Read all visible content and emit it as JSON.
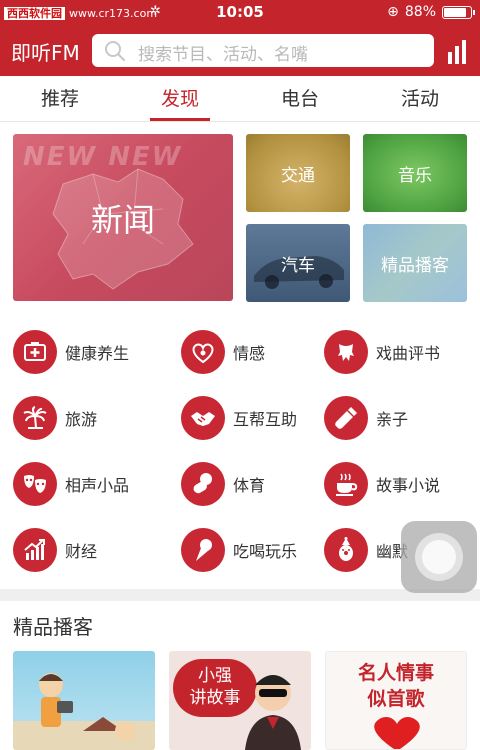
{
  "status_bar": {
    "site_name": "西西软件园",
    "site_url": "www.cr173.com",
    "time": "10:05",
    "battery_percent": "88%",
    "battery_level": 0.88
  },
  "header": {
    "brand": "即听FM",
    "search_placeholder": "搜索节目、活动、名嘴"
  },
  "tabs": [
    {
      "label": "推荐",
      "active": false
    },
    {
      "label": "发现",
      "active": true
    },
    {
      "label": "电台",
      "active": false
    },
    {
      "label": "活动",
      "active": false
    }
  ],
  "banners": {
    "news": {
      "label": "新闻",
      "ghost_text": "NEW NEW"
    },
    "traffic": {
      "label": "交通"
    },
    "music": {
      "label": "音乐"
    },
    "car": {
      "label": "汽车"
    },
    "podcast": {
      "label": "精品播客"
    }
  },
  "categories": [
    {
      "label": "健康养生",
      "icon": "first-aid-kit-icon"
    },
    {
      "label": "情感",
      "icon": "hearts-icon"
    },
    {
      "label": "戏曲评书",
      "icon": "opera-beard-icon"
    },
    {
      "label": "旅游",
      "icon": "palm-tree-icon"
    },
    {
      "label": "互帮互助",
      "icon": "handshake-icon"
    },
    {
      "label": "亲子",
      "icon": "baby-bottle-icon"
    },
    {
      "label": "相声小品",
      "icon": "theater-masks-icon"
    },
    {
      "label": "体育",
      "icon": "sports-balls-icon"
    },
    {
      "label": "故事小说",
      "icon": "tea-cup-icon"
    },
    {
      "label": "财经",
      "icon": "finance-chart-icon"
    },
    {
      "label": "吃喝玩乐",
      "icon": "ice-cream-icon"
    },
    {
      "label": "幽默",
      "icon": "clown-icon"
    }
  ],
  "podcast_section": {
    "title": "精品播客",
    "cards": [
      {
        "title": ""
      },
      {
        "title": "小强\n讲故事"
      },
      {
        "title": "名人情事\n似首歌"
      }
    ]
  },
  "colors": {
    "brand_red": "#c4252c",
    "icon_red": "#c82833"
  }
}
